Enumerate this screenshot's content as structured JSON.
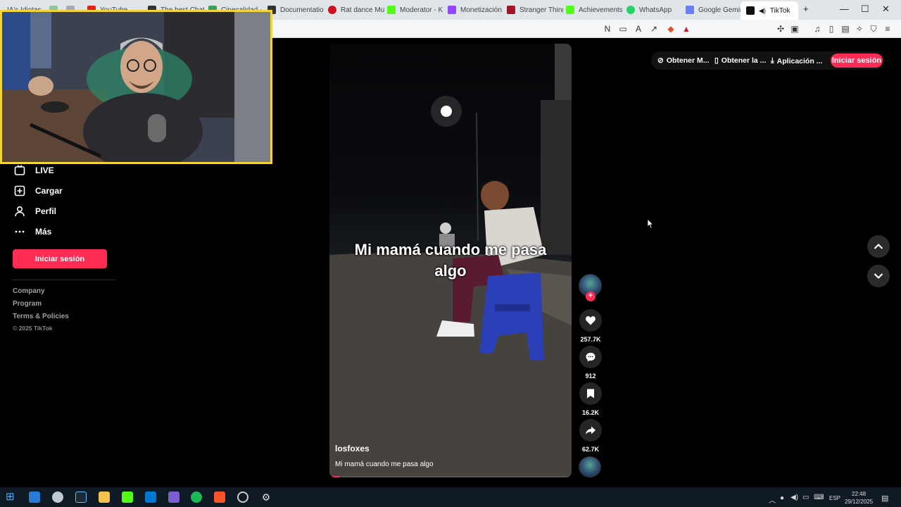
{
  "browser": {
    "tabs": [
      {
        "label": "IA's Idiotas",
        "color": "#6b6b6b"
      },
      {
        "label": "",
        "color": "#8fc8a0"
      },
      {
        "label": "",
        "color": "#9aa"
      },
      {
        "label": "YouTube",
        "color": "#e62117"
      },
      {
        "label": "The best Chat",
        "color": "#333333"
      },
      {
        "label": "Cinecalidad -",
        "color": "#3aa05a"
      },
      {
        "label": "Documentatio",
        "color": "#333333"
      },
      {
        "label": "Rat dance Mu",
        "color": "#cc1122"
      },
      {
        "label": "Moderator - K",
        "color": "#53fc18"
      },
      {
        "label": "Monetización",
        "color": "#9146ff"
      },
      {
        "label": "Stranger Thing",
        "color": "#a0152a"
      },
      {
        "label": "Achievements",
        "color": "#53fc18"
      },
      {
        "label": "WhatsApp",
        "color": "#25d366"
      },
      {
        "label": "Google Gemin",
        "color": "#6a7ff0"
      },
      {
        "label": "TikTok",
        "color": "#111111"
      }
    ],
    "new_tab": "+",
    "window_controls": {
      "minimize": "—",
      "maximize": "☐",
      "close": "✕"
    }
  },
  "nav": {
    "items": [
      {
        "label": "LIVE",
        "icon": "live-icon"
      },
      {
        "label": "Cargar",
        "icon": "upload-icon"
      },
      {
        "label": "Perfil",
        "icon": "profile-icon"
      },
      {
        "label": "Más",
        "icon": "more-icon"
      }
    ],
    "login_label": "Iniciar sesión",
    "footer": [
      "Company",
      "Program",
      "Terms & Policies"
    ],
    "copyright": "© 2025 TikTok"
  },
  "top_actions": {
    "coins": "Obtener M...",
    "app": "Obtener la ...",
    "desktop": "Aplicación ...",
    "login": "Iniciar sesión"
  },
  "video": {
    "caption": "Mi mamá cuando me pasa algo",
    "author": "losfoxes",
    "description": "Mi mamá cuando me pasa algo",
    "progress": 0.04
  },
  "actions": {
    "likes": "257.7K",
    "comments": "912",
    "saves": "16.2K",
    "shares": "62.7K",
    "follow": "+"
  },
  "taskbar": {
    "language": "ESP",
    "time": "22:48",
    "date": "29/12/2025"
  },
  "colors": {
    "brand": "#fe2c55",
    "webcam_border": "#f2d33a"
  }
}
